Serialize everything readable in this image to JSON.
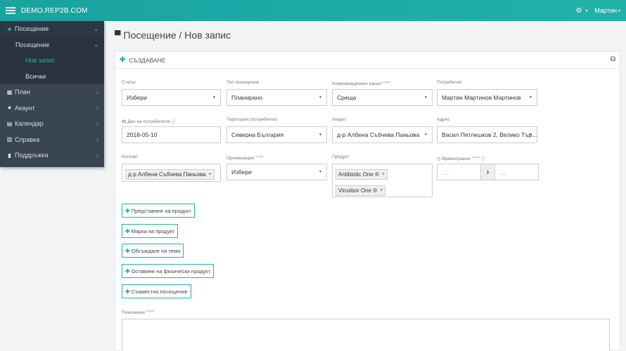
{
  "topbar": {
    "brand": "DEMO.REP2B.COM",
    "settings_caret": "▾",
    "user": "Мартин",
    "user_caret": "▾"
  },
  "sidebar": {
    "items": [
      {
        "icon": "pin-icon",
        "label": "Посещение"
      },
      {
        "label": "Посещение"
      },
      {
        "label": "Нов запис"
      },
      {
        "label": "Всички"
      },
      {
        "icon": "grid-icon",
        "label": "План"
      },
      {
        "icon": "star-icon",
        "label": "Акаунт"
      },
      {
        "icon": "calendar-icon",
        "label": "Календар"
      },
      {
        "icon": "bar-chart-icon",
        "label": "Справка"
      },
      {
        "icon": "book-icon",
        "label": "Поддръжка"
      }
    ]
  },
  "page": {
    "title": "Посещение / Нов запис"
  },
  "panel": {
    "header": "СЪЗДАВАНЕ"
  },
  "form": {
    "status": {
      "label": "Статус",
      "value": "Избери"
    },
    "visit_type": {
      "label": "Тип посещение",
      "value": "Планирано"
    },
    "comm_channel": {
      "label": "Комуникационен канал",
      "optional": "опция",
      "value": "Среща"
    },
    "user": {
      "label": "Потребител",
      "value": "Мартин Мартинов Мартинов"
    },
    "user_date": {
      "label": "Ден на потребителя",
      "value": "2018-05-10"
    },
    "territory": {
      "label": "Територия (потребител)",
      "value": "Северна България"
    },
    "account": {
      "label": "Акаунт",
      "value": "д-р Албена Събчева Паньова"
    },
    "address": {
      "label": "Адрес",
      "value": "Васил Петлешков 2, Велико Тър..."
    },
    "contact": {
      "label": "Контакт",
      "tag": "д-р Албена Събчева Паньова"
    },
    "organization": {
      "label": "Организация",
      "optional": "опция",
      "value": "Избери"
    },
    "product": {
      "label": "Продукт",
      "tags": [
        "Antibiotic One ®",
        "Virusbor One ®"
      ]
    },
    "duration": {
      "label": "Времетраене",
      "optional": "опция",
      "placeholder_from": "_:_",
      "placeholder_to": "_:_"
    },
    "note": {
      "label": "Пояснение",
      "optional": "опция"
    }
  },
  "actions": [
    "Представяне на продукт",
    "Мярка на продукт",
    "Обсъждане на тема",
    "Оставяне на физически продукт",
    "Съвместно посещение"
  ],
  "colors": {
    "accent": "#20b2aa",
    "sidebar_bg": "#3a4554",
    "topbar": "#1aa3a0"
  }
}
